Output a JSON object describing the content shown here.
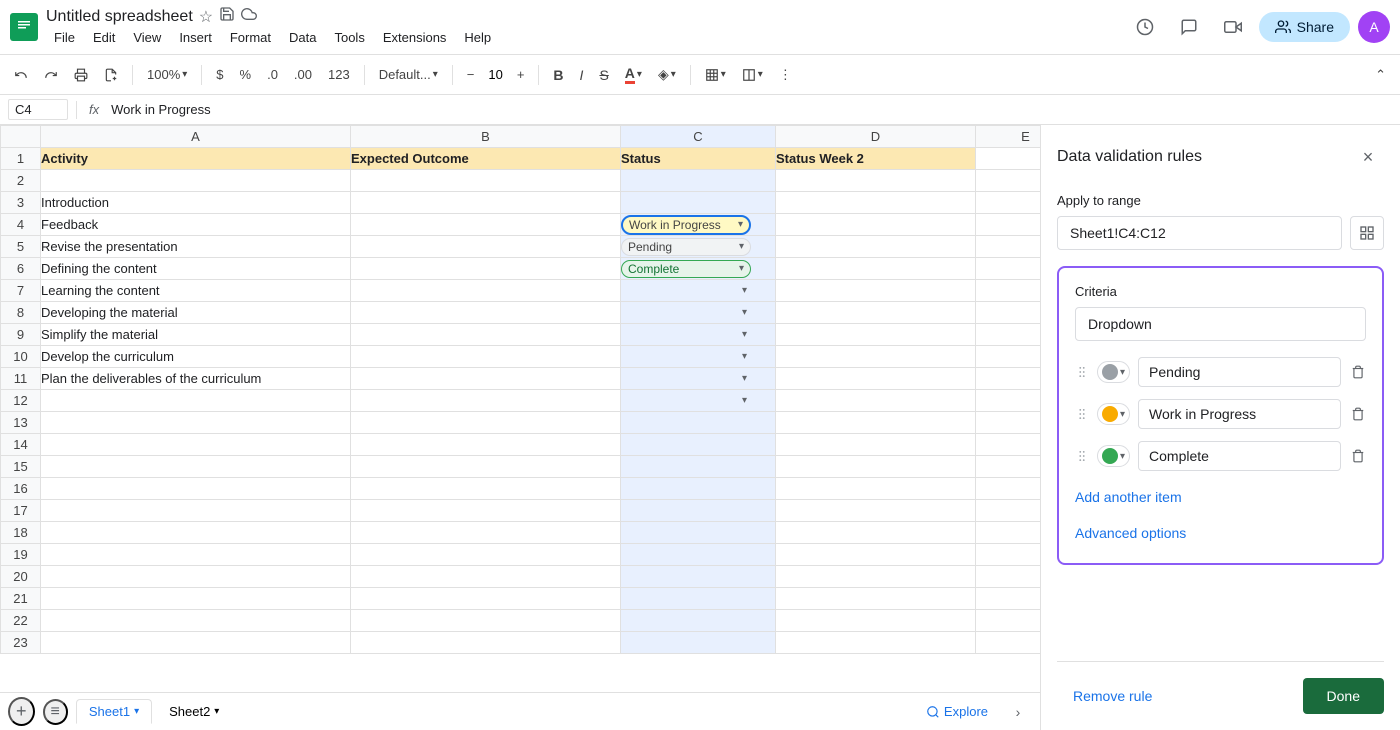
{
  "app": {
    "logo": "G",
    "title": "Untitled spreadsheet",
    "star_icon": "★",
    "cloud_icon": "☁",
    "history_icon": "🕐"
  },
  "menu": {
    "items": [
      "File",
      "Edit",
      "View",
      "Insert",
      "Format",
      "Data",
      "Tools",
      "Extensions",
      "Help"
    ]
  },
  "toolbar": {
    "undo": "↩",
    "redo": "↪",
    "print": "🖨",
    "paint": "🖌",
    "zoom": "100%",
    "currency": "$",
    "percent": "%",
    "decimal_dec": ".0",
    "decimal_inc": ".00",
    "format_num": "123",
    "font": "Default...",
    "font_size": "10",
    "bold": "B",
    "italic": "I",
    "strikethrough": "S̶",
    "font_color": "A",
    "fill_color": "◈",
    "borders": "⊞",
    "merge": "⊡",
    "more": "⋮",
    "collapse": "⌃"
  },
  "formula_bar": {
    "cell_ref": "C4",
    "fx": "fx",
    "value": "Work in Progress"
  },
  "columns": {
    "headers": [
      "",
      "A",
      "B",
      "C",
      "D",
      "E"
    ],
    "col_a_label": "Activity",
    "col_b_label": "Expected Outcome",
    "col_c_label": "Status",
    "col_d_label": "Status Week 2"
  },
  "rows": [
    {
      "num": 1,
      "a": "Activity",
      "b": "Expected Outcome",
      "c": "Status",
      "d": "Status Week 2",
      "is_header": true
    },
    {
      "num": 2,
      "a": "",
      "b": "",
      "c": "",
      "d": ""
    },
    {
      "num": 3,
      "a": "Introduction",
      "b": "",
      "c": "",
      "d": ""
    },
    {
      "num": 4,
      "a": "Feedback",
      "b": "",
      "c": "Work in Progress",
      "d": "",
      "c_type": "work-in-progress",
      "c_selected": true
    },
    {
      "num": 5,
      "a": "Revise the presentation",
      "b": "",
      "c": "Pending",
      "d": "",
      "c_type": "pending"
    },
    {
      "num": 6,
      "a": "Defining the content",
      "b": "",
      "c": "Complete",
      "d": "",
      "c_type": "complete"
    },
    {
      "num": 7,
      "a": "Learning the content",
      "b": "",
      "c": "",
      "d": ""
    },
    {
      "num": 8,
      "a": "Developing the material",
      "b": "",
      "c": "",
      "d": ""
    },
    {
      "num": 9,
      "a": "Simplify the material",
      "b": "",
      "c": "",
      "d": ""
    },
    {
      "num": 10,
      "a": "Develop the curriculum",
      "b": "",
      "c": "",
      "d": ""
    },
    {
      "num": 11,
      "a": "Plan the deliverables of the curriculum",
      "b": "",
      "c": "",
      "d": ""
    },
    {
      "num": 12,
      "a": "",
      "b": "",
      "c": "",
      "d": ""
    },
    {
      "num": 13,
      "a": "",
      "b": "",
      "c": "",
      "d": ""
    },
    {
      "num": 14,
      "a": "",
      "b": "",
      "c": "",
      "d": ""
    },
    {
      "num": 15,
      "a": "",
      "b": "",
      "c": "",
      "d": ""
    },
    {
      "num": 16,
      "a": "",
      "b": "",
      "c": "",
      "d": ""
    },
    {
      "num": 17,
      "a": "",
      "b": "",
      "c": "",
      "d": ""
    },
    {
      "num": 18,
      "a": "",
      "b": "",
      "c": "",
      "d": ""
    },
    {
      "num": 19,
      "a": "",
      "b": "",
      "c": "",
      "d": ""
    },
    {
      "num": 20,
      "a": "",
      "b": "",
      "c": "",
      "d": ""
    },
    {
      "num": 21,
      "a": "",
      "b": "",
      "c": "",
      "d": ""
    },
    {
      "num": 22,
      "a": "",
      "b": "",
      "c": "",
      "d": ""
    },
    {
      "num": 23,
      "a": "",
      "b": "",
      "c": "",
      "d": ""
    }
  ],
  "panel": {
    "title": "Data validation rules",
    "close_label": "×",
    "apply_label": "Apply to range",
    "range_value": "Sheet1!C4:C12",
    "criteria_label": "Criteria",
    "dropdown_value": "Dropdown",
    "items": [
      {
        "color": "#9aa0a6",
        "color_name": "gray",
        "label": "Pending"
      },
      {
        "color": "#f9ab00",
        "color_name": "yellow",
        "label": "Work in Progress"
      },
      {
        "color": "#34a853",
        "color_name": "green",
        "label": "Complete"
      }
    ],
    "add_item_label": "Add another item",
    "advanced_label": "Advanced options",
    "remove_rule_label": "Remove rule",
    "done_label": "Done"
  },
  "bottom_bar": {
    "add_sheet": "+",
    "sheet1_label": "Sheet1",
    "sheet2_label": "Sheet2",
    "explore_label": "Explore",
    "sidebar_icon": "≡"
  }
}
